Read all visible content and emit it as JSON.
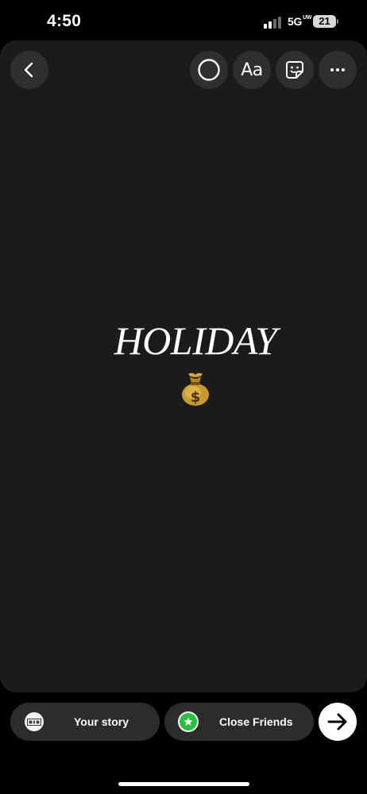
{
  "status_bar": {
    "time": "4:50",
    "network": "5G",
    "network_sub": "UW",
    "battery": "21"
  },
  "toolbar": {
    "back_icon": "chevron-left-icon",
    "draw_icon": "circle-icon",
    "text_label": "Aa",
    "sticker_icon": "sticker-icon",
    "more_icon": "more-horizontal-icon"
  },
  "story": {
    "text": "HOLIDAY",
    "emoji": "money-bag"
  },
  "share": {
    "your_story_label": "Your story",
    "close_friends_label": "Close Friends",
    "next_icon": "arrow-right-icon",
    "close_friends_color": "#25c03c"
  }
}
